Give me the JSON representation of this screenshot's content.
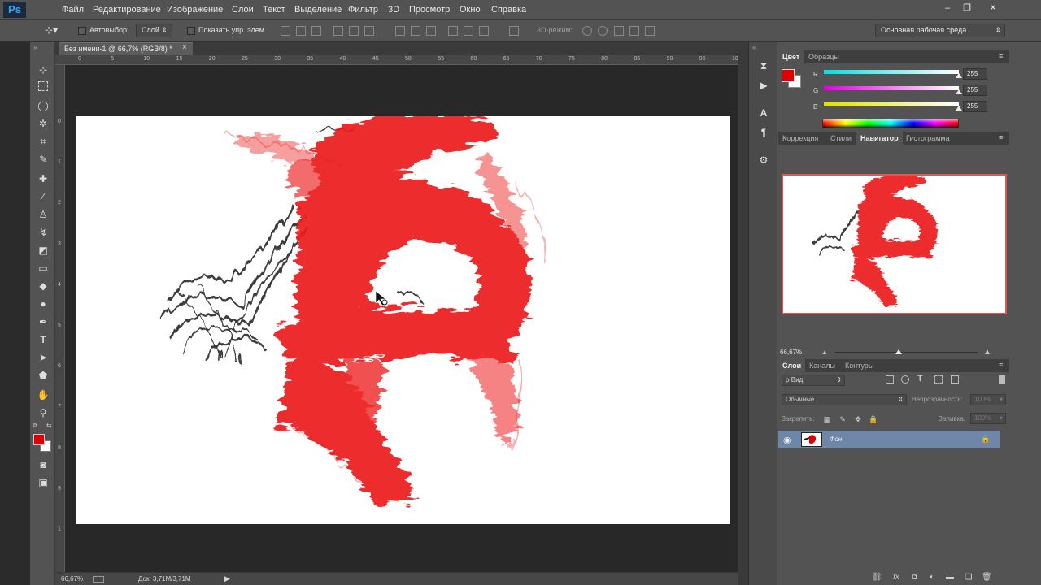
{
  "app": {
    "logo": "Ps",
    "menu": [
      "Файл",
      "Редактирование",
      "Изображение",
      "Слои",
      "Текст",
      "Выделение",
      "Фильтр",
      "3D",
      "Просмотр",
      "Окно",
      "Справка"
    ],
    "window_controls": [
      "–",
      "❐",
      "✕"
    ]
  },
  "options_bar": {
    "autoselect_label": "Автовыбор:",
    "autoselect_value": "Слой",
    "show_transform_label": "Показать упр. элем.",
    "mode_3d_label": "3D-режим:",
    "workspace": "Основная рабочая среда"
  },
  "document": {
    "tab_title": "Без имени-1 @ 66,7% (RGB/8) *",
    "close_glyph": "×",
    "h_ruler_ticks": [
      "0",
      "5",
      "10",
      "15",
      "20",
      "25",
      "30",
      "35",
      "40",
      "45",
      "50",
      "55",
      "60",
      "65",
      "70",
      "75",
      "80",
      "85",
      "90",
      "95",
      "10"
    ],
    "v_ruler_ticks": [
      "0",
      "1",
      "2",
      "3",
      "4",
      "5",
      "6",
      "7",
      "8",
      "9",
      "1"
    ],
    "status_zoom": "66,67%",
    "status_doc": "Док: 3,71M/3,71M",
    "status_arrow": "▶"
  },
  "color_panel": {
    "tabs": [
      "Цвет",
      "Образцы"
    ],
    "active_tab": "Цвет",
    "foreground": "#e00000",
    "background": "#ffffff",
    "channels": [
      {
        "label": "R",
        "value": "255",
        "color_from": "#00e0e0",
        "color_to": "#ffffff",
        "level": 1.0
      },
      {
        "label": "G",
        "value": "255",
        "color_from": "#e000e0",
        "color_to": "#ffffff",
        "level": 1.0
      },
      {
        "label": "B",
        "value": "255",
        "color_from": "#e0e000",
        "color_to": "#ffffff",
        "level": 1.0
      }
    ]
  },
  "navigator_panel": {
    "tabs": [
      "Коррекция",
      "Стили",
      "Навигатор",
      "Гистограмма"
    ],
    "active_tab": "Навигатор",
    "zoom": "66,67%",
    "zoom_level": 0.45
  },
  "layers_panel": {
    "tabs": [
      "Слои",
      "Каналы",
      "Контуры"
    ],
    "active_tab": "Слои",
    "filter_kind": "ρ Вид",
    "blend_mode": "Обычные",
    "opacity_label": "Непрозрачность:",
    "opacity_value": "100%",
    "lock_label": "Закрепить:",
    "fill_label": "Заливка:",
    "fill_value": "100%",
    "layers": [
      {
        "name": "Фон",
        "visible": true,
        "locked": true
      }
    ]
  },
  "colors": {
    "accent_red": "#e00000",
    "selected_layer": "#6e86a8",
    "ui_gray": "#535353"
  }
}
